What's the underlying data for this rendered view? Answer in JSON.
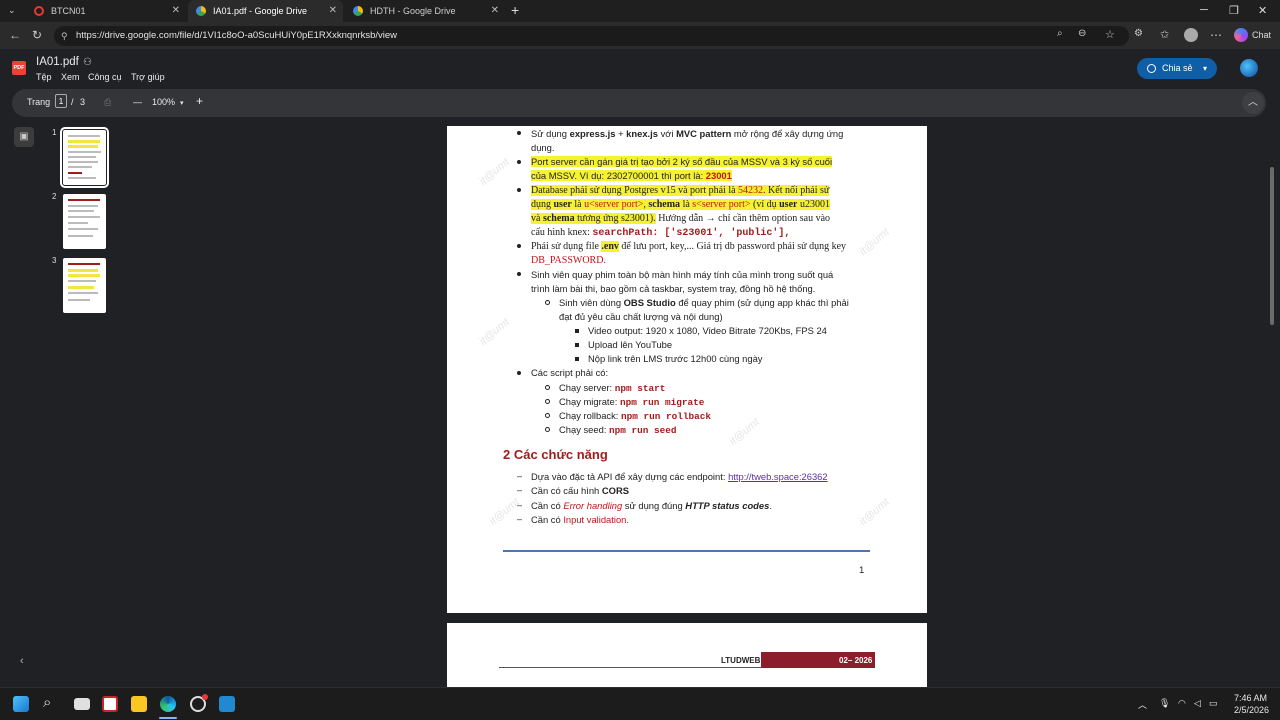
{
  "browser": {
    "tabs": [
      {
        "label": "BTCN01",
        "color": "#e53935"
      },
      {
        "label": "IA01.pdf - Google Drive",
        "color": "#34a853"
      },
      {
        "label": "HDTH - Google Drive",
        "color": "#34a853"
      }
    ],
    "url": "https://drive.google.com/file/d/1VI1c8oO-a0ScuHUiY0pE1RXxknqnrksb/view",
    "chat_label": "Chat"
  },
  "drive": {
    "file_name": "IA01.pdf",
    "pdf_badge": "PDF",
    "menu": [
      "Tệp",
      "Xem",
      "Công cụ",
      "Trợ giúp"
    ],
    "share_label": "Chia sẻ"
  },
  "toolbar": {
    "page_label": "Trang",
    "page_current": "1",
    "page_sep": "/",
    "page_total": "3",
    "zoom": "100%",
    "minus": "—",
    "plus": "+"
  },
  "thumbnails": [
    "1",
    "2",
    "3"
  ],
  "doc": {
    "l1a": "Sử dụng ",
    "l1b": "express.js",
    "l1c": " + ",
    "l1d": "knex.js",
    "l1e": " với ",
    "l1f": "MVC pattern",
    "l1g": " mở rộng để xây dựng ứng",
    "l1h": "dụng.",
    "l2a": "Port server cần gán giá trị tạo bởi 2 ký số đầu của MSSV và 3 ký số cuối",
    "l2b": "của MSSV. Ví dụ: 2302700001 thì port là: ",
    "l2c": "23001",
    "l3a": "Database phải sử dụng Postgres v15 và port phải là ",
    "l3b": "54232",
    "l3c": ". Kết nối phải sử",
    "l4a": "dụng ",
    "l4b": "user",
    "l4c": " là ",
    "l4d": "u<server port>",
    "l4e": ", ",
    "l4f": "schema",
    "l4g": " là ",
    "l4h": "s<server port>",
    "l4i": " (ví dụ ",
    "l4j": "user",
    "l4k": " u23001",
    "l5a": "và ",
    "l5b": "schema",
    "l5c": " tương ứng s23001).",
    "l5d": " Hướng dẫn → chỉ cần thêm option sau vào",
    "l6a": "cấu hình knex: ",
    "l6b": "searchPath: ['s23001', 'public'],",
    "l7a": "Phải sử dụng file ",
    "l7b": ".env",
    "l7c": " để lưu port, key,... Giá trị db password phải sử dụng key",
    "l8": "DB_PASSWORD.",
    "l9": "Sinh viên quay phim toàn bộ màn hình máy tính của mình trong suốt quá",
    "l10": "trình làm bài thi, bao gồm cả taskbar, system tray, đồng hồ hệ thống.",
    "l11a": "Sinh viên dùng ",
    "l11b": "OBS Studio",
    "l11c": " để quay phim (sử dụng app khác thì phải",
    "l12": "đạt đủ yêu cầu chất lượng và nội dung)",
    "l13": "Video output: 1920 x 1080, Video Bitrate 720Kbs, FPS 24",
    "l14": "Upload lên YouTube",
    "l15": "Nộp link trên LMS trước 12h00 cùng ngày",
    "l16": "Các script phải có:",
    "l17a": "Chạy server: ",
    "l17b": "npm start",
    "l18a": "Chạy migrate: ",
    "l18b": "npm run migrate",
    "l19a": "Chạy rollback: ",
    "l19b": "npm run rollback",
    "l20a": "Chạy seed: ",
    "l20b": "npm run seed",
    "h2": "2   Các chức năng",
    "dash": "–",
    "f1a": "Dựa vào đặc tả API để xây dựng các endpoint: ",
    "f1b": "http://tweb.space:26362",
    "f2a": "Cần có cấu hình ",
    "f2b": "CORS",
    "f3a": "Cần có ",
    "f3b": "Error handling",
    "f3c": " sử dụng đúng ",
    "f3d": "HTTP status codes",
    "f3e": ".",
    "f4a": "Cần có ",
    "f4b": "Input validation.",
    "page_number": "1",
    "watermark": "it@umt",
    "p2_left": "LTUDWEB",
    "p2_right": "02– 2026"
  },
  "tray": {
    "time": "7:46 AM",
    "date": "2/5/2026"
  }
}
